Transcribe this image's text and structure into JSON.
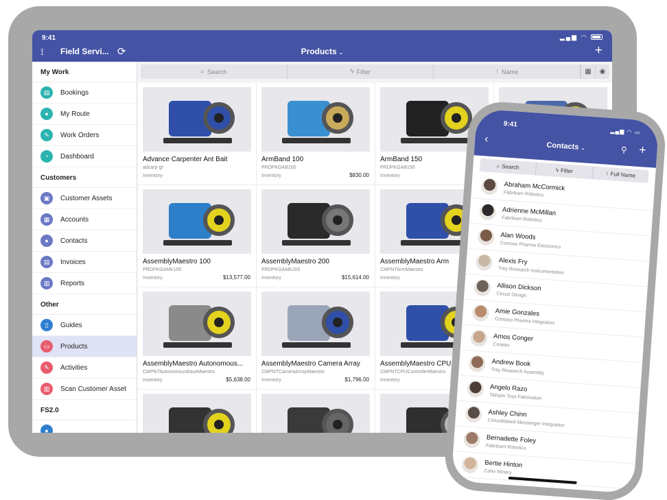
{
  "colors": {
    "header": "#4453a4",
    "active_item": "#dfe3f5",
    "frame": "#a8a8a8"
  },
  "tablet": {
    "status_time": "9:41",
    "app_title": "Field Servi...",
    "page_title": "Products",
    "toolbar": {
      "search": "Search",
      "filter": "Filter",
      "sort": "Name"
    },
    "sidebar": {
      "sections": [
        {
          "title": "My Work",
          "items": [
            {
              "label": "Bookings",
              "icon": "calendar-check-icon",
              "color": "#2bb3b0"
            },
            {
              "label": "My Route",
              "icon": "map-pin-icon",
              "color": "#2bb3b0"
            },
            {
              "label": "Work Orders",
              "icon": "wrench-icon",
              "color": "#2bb3b0"
            },
            {
              "label": "Dashboard",
              "icon": "gauge-icon",
              "color": "#2bb3b0"
            }
          ]
        },
        {
          "title": "Customers",
          "items": [
            {
              "label": "Customer Assets",
              "icon": "asset-icon",
              "color": "#6b78c4"
            },
            {
              "label": "Accounts",
              "icon": "building-icon",
              "color": "#6b78c4"
            },
            {
              "label": "Contacts",
              "icon": "person-icon",
              "color": "#6b78c4"
            },
            {
              "label": "Invoices",
              "icon": "invoice-icon",
              "color": "#6b78c4"
            },
            {
              "label": "Reports",
              "icon": "report-icon",
              "color": "#6b78c4"
            }
          ]
        },
        {
          "title": "Other",
          "items": [
            {
              "label": "Guides",
              "icon": "book-icon",
              "color": "#2f7fd0"
            },
            {
              "label": "Products",
              "icon": "product-icon",
              "color": "#e85d6e",
              "active": true
            },
            {
              "label": "Activities",
              "icon": "pencil-icon",
              "color": "#e85d6e"
            },
            {
              "label": "Scan Customer Asset",
              "icon": "barcode-icon",
              "color": "#e85d6e"
            }
          ]
        },
        {
          "title": "FS2.0",
          "items": []
        }
      ]
    },
    "products": [
      {
        "name": "Advance Carpenter Ant Bait",
        "code": "adcarp-gr",
        "category": "Inventory",
        "price": "",
        "body": "#2f4fa8",
        "wheel": "#2f4fa8"
      },
      {
        "name": "ArmBand 100",
        "code": "PRDPKGAB100",
        "category": "Inventory",
        "price": "$830.00",
        "body": "#3a8fd0",
        "wheel": "#c9a95a"
      },
      {
        "name": "ArmBand 150",
        "code": "PRDPKGAB150",
        "category": "Inventory",
        "price": "",
        "body": "#222222",
        "wheel": "#e3d21e"
      },
      {
        "name": "",
        "code": "",
        "category": "",
        "price": "",
        "body": "#4a6aa8",
        "wheel": "#e3d21e"
      },
      {
        "name": "AssemblyMaestro 100",
        "code": "PRDPKGAMK100",
        "category": "Inventory",
        "price": "$13,577.00",
        "body": "#2e7fc9",
        "wheel": "#e3d21e"
      },
      {
        "name": "AssemblyMaestro 200",
        "code": "PRDPKGAMK200",
        "category": "Inventory",
        "price": "$15,614.00",
        "body": "#2a2a2a",
        "wheel": "#777777"
      },
      {
        "name": "AssemblyMaestro Arm",
        "code": "CMPNTArmMaestro",
        "category": "Inventory",
        "price": "",
        "body": "#2f4fa8",
        "wheel": "#e3d21e"
      },
      {
        "name": "",
        "code": "",
        "category": "",
        "price": "",
        "body": "#3c3c3c",
        "wheel": "#e3d21e"
      },
      {
        "name": "AssemblyMaestro Autonomous...",
        "code": "CMPNTAutonomousBaseMaestro",
        "category": "Inventory",
        "price": "$5,638.00",
        "body": "#8a8a8a",
        "wheel": "#e3d21e"
      },
      {
        "name": "AssemblyMaestro Camera Array",
        "code": "CMPNTCameraArrayMaestro",
        "category": "Inventory",
        "price": "$1,796.00",
        "body": "#9aa6b8",
        "wheel": "#2f4fa8"
      },
      {
        "name": "AssemblyMaestro CPU + ...",
        "code": "CMPNTCPUControllerMaestro",
        "category": "Inventory",
        "price": "",
        "body": "#2f4fa8",
        "wheel": "#e3d21e"
      },
      {
        "name": "",
        "code": "",
        "category": "",
        "price": "",
        "body": "#555555",
        "wheel": "#999999"
      },
      {
        "name": "",
        "code": "",
        "category": "",
        "price": "",
        "body": "#333333",
        "wheel": "#e3d21e"
      },
      {
        "name": "",
        "code": "",
        "category": "",
        "price": "",
        "body": "#3a3a3a",
        "wheel": "#666666"
      },
      {
        "name": "",
        "code": "",
        "category": "",
        "price": "",
        "body": "#2f2f2f",
        "wheel": "#bbbbbb"
      },
      {
        "name": "",
        "code": "",
        "category": "",
        "price": "",
        "body": "#444444",
        "wheel": "#888888"
      }
    ]
  },
  "phone": {
    "status_time": "9:41",
    "page_title": "Contacts",
    "toolbar": {
      "search": "Search",
      "filter": "Filter",
      "sort": "Full Name"
    },
    "contacts": [
      {
        "name": "Abraham McCormick",
        "company": "Fabrikam Robotics",
        "color": "#5b4a42"
      },
      {
        "name": "Adrienne McMillan",
        "company": "Fabrikam Robotics",
        "color": "#2b2b2b"
      },
      {
        "name": "Alan Woods",
        "company": "Contoso Pharma Electronics",
        "color": "#7a5a48"
      },
      {
        "name": "Alexis Fry",
        "company": "Trey Research Instrumentation",
        "color": "#c9b7a6"
      },
      {
        "name": "Allison Dickson",
        "company": "Circuit Design",
        "color": "#6e6259"
      },
      {
        "name": "Amie Gonzales",
        "company": "Contoso Pharma Integration",
        "color": "#b98a6c"
      },
      {
        "name": "Amos Conger",
        "company": "Coratev",
        "color": "#c8a58d"
      },
      {
        "name": "Andrew Book",
        "company": "Trey Research Assembly",
        "color": "#8d6b57"
      },
      {
        "name": "Angelo Razo",
        "company": "Tailspin Toys Fabrication",
        "color": "#4d3f38"
      },
      {
        "name": "Ashley Chinn",
        "company": "Consolidated Messenger Integration",
        "color": "#5a4c46"
      },
      {
        "name": "Bernadette Foley",
        "company": "Fabrikam Robotics",
        "color": "#9d7a66"
      },
      {
        "name": "Bertie Hinton",
        "company": "Coho Winery",
        "color": "#d2b49a"
      }
    ]
  }
}
